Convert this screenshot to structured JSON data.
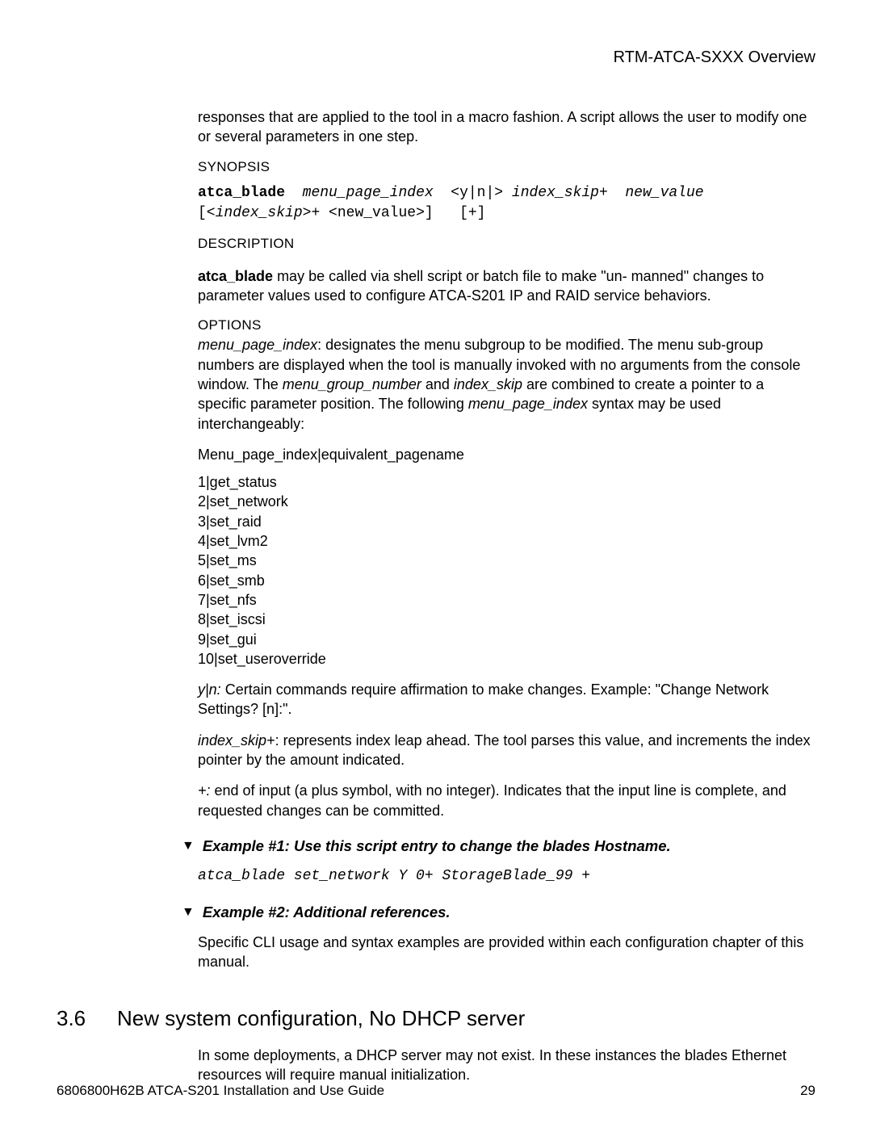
{
  "header": {
    "title": "RTM-ATCA-SXXX Overview"
  },
  "intro": "responses that are applied to the tool in a macro fashion.  A script allows the user to modify one or several parameters in one step.",
  "synopsis_label": "SYNOPSIS",
  "synopsis": {
    "cmd": "atca_blade",
    "arg1": "menu_page_index",
    "arg_yn": "<y|n|>",
    "arg2": "index_skip",
    "plus1": "+",
    "arg3": "new_value",
    "line2_a": "[<",
    "line2_b": "index_skip",
    "line2_c": ">+ <new_value>]",
    "line2_d": "[+]"
  },
  "description_label": "DESCRIPTION",
  "description": {
    "lead": "atca_blade",
    "rest": " may be called via shell script or batch file to make \"un- manned\" changes to parameter values used to configure  ATCA-S201 IP and RAID service behaviors."
  },
  "options_label": "OPTIONS",
  "options_intro": {
    "lead": " menu_page_index",
    "text1": ": designates the menu subgroup to be modified.  The menu sub-group numbers are displayed when the tool is manually invoked with no arguments from the console window. The ",
    "i1": "menu_group_number",
    "mid": " and ",
    "i2": "index_skip",
    "text2": " are combined to create a pointer to a specific parameter position.  The following ",
    "i3": "menu_page_index",
    "text3": " syntax may be used interchangeably:"
  },
  "menu_header": "Menu_page_index|equivalent_pagename",
  "menu_items": [
    "1|get_status",
    "2|set_network",
    "3|set_raid",
    "4|set_lvm2",
    "5|set_ms",
    "6|set_smb",
    "7|set_nfs",
    "8|set_iscsi",
    "9|set_gui",
    "10|set_useroverride"
  ],
  "yn": {
    "lead": "y|n:",
    "text": "  Certain commands require affirmation to make changes.  Example:  \"Change Network Settings? [n]:\"."
  },
  "idx": {
    "lead": "index_skip+",
    "text": ": represents index leap ahead.  The tool parses this value, and increments the index pointer by the amount indicated."
  },
  "plus": {
    "lead": "+:",
    "text": "  end of input (a plus symbol, with no integer).   Indicates that the input line is complete, and requested changes can be committed."
  },
  "example1": {
    "title": "Example #1: Use this script entry to change the blades Hostname.",
    "code": "atca_blade set_network Y 0+ StorageBlade_99 +"
  },
  "example2": {
    "title": "Example #2: Additional references.",
    "text": "Specific CLI usage and syntax examples are provided within each configuration chapter of this manual."
  },
  "section": {
    "num": "3.6",
    "title": "New system configuration, No DHCP server",
    "text": "In some deployments, a DHCP server may not exist.  In these instances the blades Ethernet resources will require manual initialization."
  },
  "footer": {
    "left": "6806800H62B ATCA-S201 Installation and Use Guide",
    "right": "29"
  }
}
